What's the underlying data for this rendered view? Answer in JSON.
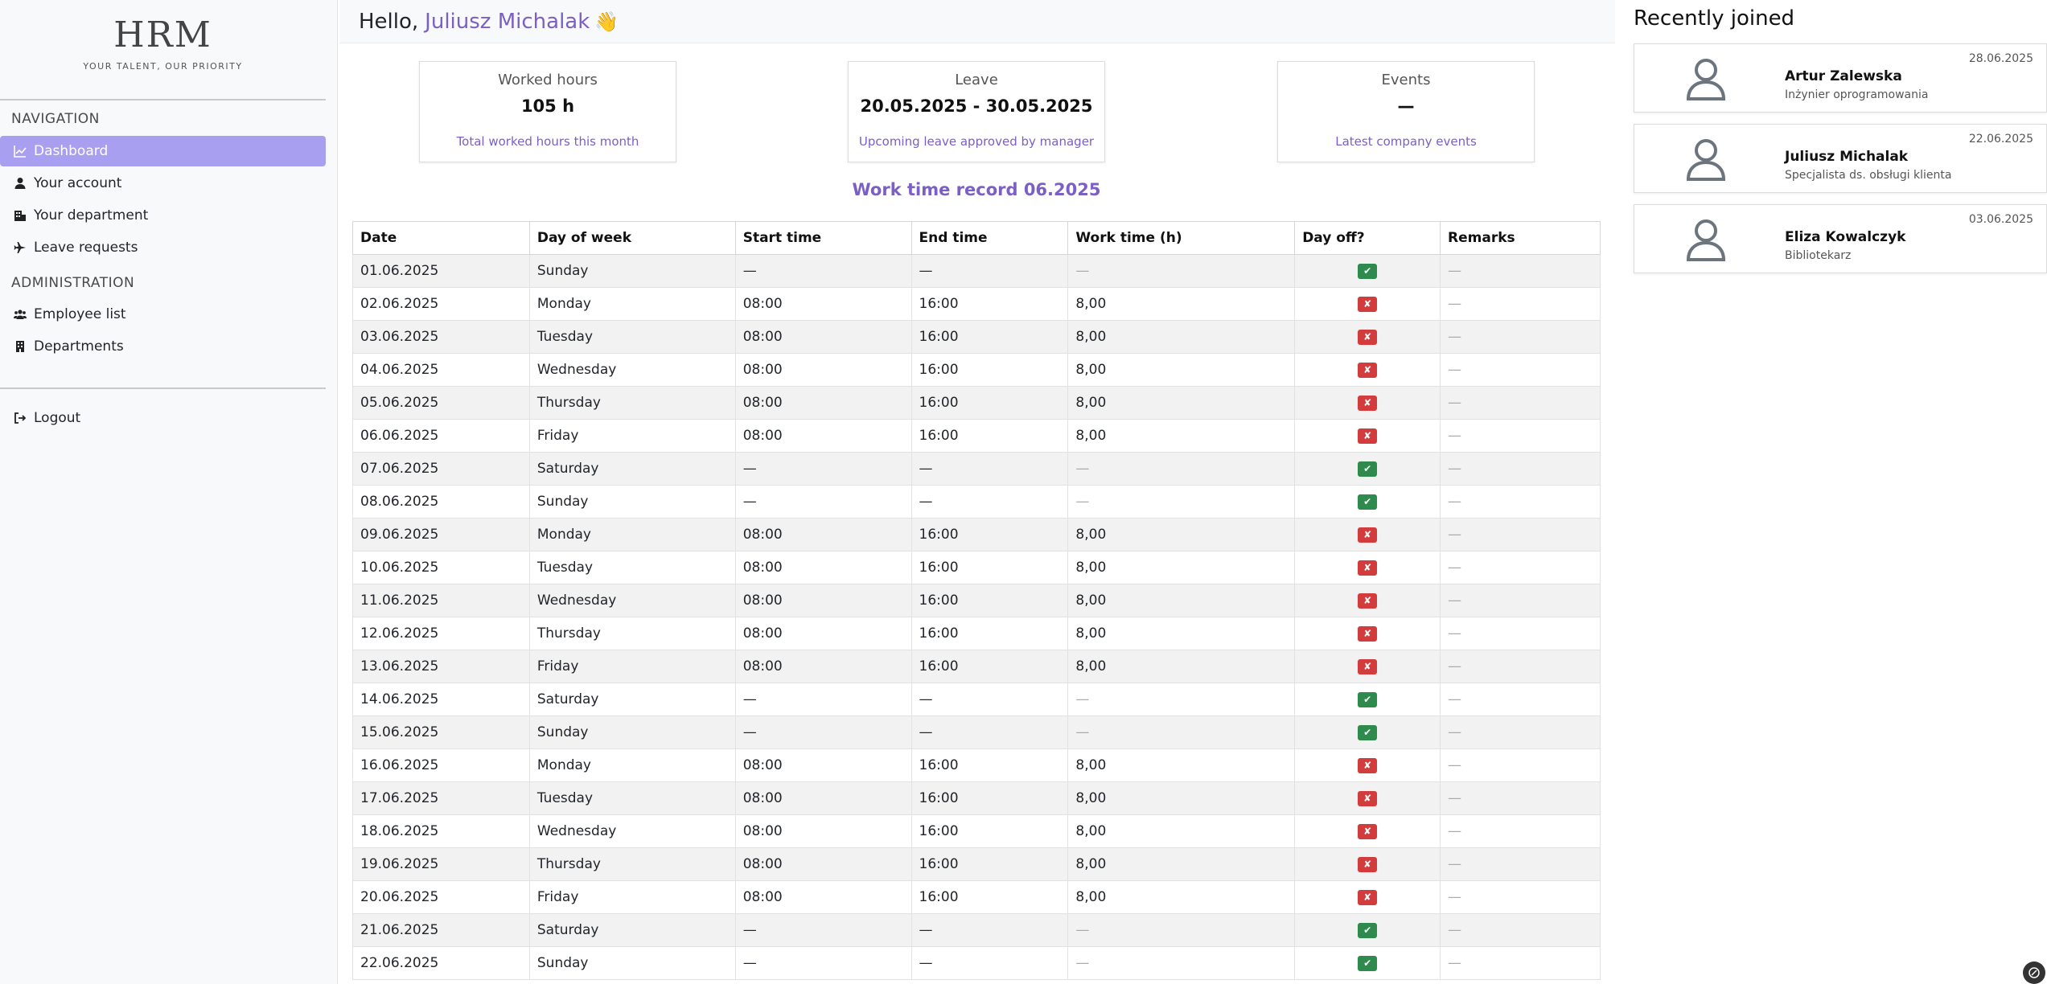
{
  "logo": {
    "title": "HRM",
    "subtitle": "YOUR TALENT, OUR PRIORITY"
  },
  "sidebar": {
    "navigation_heading": "NAVIGATION",
    "nav_items": [
      {
        "label": "Dashboard",
        "icon": "chart-line-icon",
        "active": true
      },
      {
        "label": "Your account",
        "icon": "user-icon"
      },
      {
        "label": "Your department",
        "icon": "building-icon"
      },
      {
        "label": "Leave requests",
        "icon": "plane-icon"
      }
    ],
    "administration_heading": "ADMINISTRATION",
    "admin_items": [
      {
        "label": "Employee list",
        "icon": "users-icon"
      },
      {
        "label": "Departments",
        "icon": "building-icon"
      }
    ],
    "logout_label": "Logout"
  },
  "header": {
    "greeting": "Hello,",
    "user_name": "Juliusz Michalak",
    "wave": "👋"
  },
  "cards": {
    "worked": {
      "title": "Worked hours",
      "value": "105 h",
      "desc": "Total worked hours this month"
    },
    "leave": {
      "title": "Leave",
      "value": "20.05.2025 - 30.05.2025",
      "desc": "Upcoming leave approved by manager"
    },
    "events": {
      "title": "Events",
      "value": "—",
      "desc": "Latest company events"
    }
  },
  "section_title": "Work time record 06.2025",
  "table": {
    "headers": [
      "Date",
      "Day of week",
      "Start time",
      "End time",
      "Work time (h)",
      "Day off?",
      "Remarks"
    ],
    "rows": [
      {
        "date": "01.06.2025",
        "day": "Sunday",
        "start": "—",
        "end": "—",
        "hours": "—",
        "off": true,
        "remarks": "—"
      },
      {
        "date": "02.06.2025",
        "day": "Monday",
        "start": "08:00",
        "end": "16:00",
        "hours": "8,00",
        "off": false,
        "remarks": "—"
      },
      {
        "date": "03.06.2025",
        "day": "Tuesday",
        "start": "08:00",
        "end": "16:00",
        "hours": "8,00",
        "off": false,
        "remarks": "—"
      },
      {
        "date": "04.06.2025",
        "day": "Wednesday",
        "start": "08:00",
        "end": "16:00",
        "hours": "8,00",
        "off": false,
        "remarks": "—"
      },
      {
        "date": "05.06.2025",
        "day": "Thursday",
        "start": "08:00",
        "end": "16:00",
        "hours": "8,00",
        "off": false,
        "remarks": "—"
      },
      {
        "date": "06.06.2025",
        "day": "Friday",
        "start": "08:00",
        "end": "16:00",
        "hours": "8,00",
        "off": false,
        "remarks": "—"
      },
      {
        "date": "07.06.2025",
        "day": "Saturday",
        "start": "—",
        "end": "—",
        "hours": "—",
        "off": true,
        "remarks": "—"
      },
      {
        "date": "08.06.2025",
        "day": "Sunday",
        "start": "—",
        "end": "—",
        "hours": "—",
        "off": true,
        "remarks": "—"
      },
      {
        "date": "09.06.2025",
        "day": "Monday",
        "start": "08:00",
        "end": "16:00",
        "hours": "8,00",
        "off": false,
        "remarks": "—"
      },
      {
        "date": "10.06.2025",
        "day": "Tuesday",
        "start": "08:00",
        "end": "16:00",
        "hours": "8,00",
        "off": false,
        "remarks": "—"
      },
      {
        "date": "11.06.2025",
        "day": "Wednesday",
        "start": "08:00",
        "end": "16:00",
        "hours": "8,00",
        "off": false,
        "remarks": "—"
      },
      {
        "date": "12.06.2025",
        "day": "Thursday",
        "start": "08:00",
        "end": "16:00",
        "hours": "8,00",
        "off": false,
        "remarks": "—"
      },
      {
        "date": "13.06.2025",
        "day": "Friday",
        "start": "08:00",
        "end": "16:00",
        "hours": "8,00",
        "off": false,
        "remarks": "—"
      },
      {
        "date": "14.06.2025",
        "day": "Saturday",
        "start": "—",
        "end": "—",
        "hours": "—",
        "off": true,
        "remarks": "—"
      },
      {
        "date": "15.06.2025",
        "day": "Sunday",
        "start": "—",
        "end": "—",
        "hours": "—",
        "off": true,
        "remarks": "—"
      },
      {
        "date": "16.06.2025",
        "day": "Monday",
        "start": "08:00",
        "end": "16:00",
        "hours": "8,00",
        "off": false,
        "remarks": "—"
      },
      {
        "date": "17.06.2025",
        "day": "Tuesday",
        "start": "08:00",
        "end": "16:00",
        "hours": "8,00",
        "off": false,
        "remarks": "—"
      },
      {
        "date": "18.06.2025",
        "day": "Wednesday",
        "start": "08:00",
        "end": "16:00",
        "hours": "8,00",
        "off": false,
        "remarks": "—"
      },
      {
        "date": "19.06.2025",
        "day": "Thursday",
        "start": "08:00",
        "end": "16:00",
        "hours": "8,00",
        "off": false,
        "remarks": "—"
      },
      {
        "date": "20.06.2025",
        "day": "Friday",
        "start": "08:00",
        "end": "16:00",
        "hours": "8,00",
        "off": false,
        "remarks": "—"
      },
      {
        "date": "21.06.2025",
        "day": "Saturday",
        "start": "—",
        "end": "—",
        "hours": "—",
        "off": true,
        "remarks": "—"
      },
      {
        "date": "22.06.2025",
        "day": "Sunday",
        "start": "—",
        "end": "—",
        "hours": "—",
        "off": true,
        "remarks": "—"
      }
    ]
  },
  "badges": {
    "yes": "✔",
    "no": "✘",
    "yes_color": "#2f8a4e",
    "no_color": "#d23c3c"
  },
  "recently_joined": {
    "title": "Recently joined",
    "people": [
      {
        "name": "Artur Zalewska",
        "role": "Inżynier oprogramowania",
        "date": "28.06.2025"
      },
      {
        "name": "Juliusz Michalak",
        "role": "Specjalista ds. obsługi klienta",
        "date": "22.06.2025"
      },
      {
        "name": "Eliza Kowalczyk",
        "role": "Bibliotekarz",
        "date": "03.06.2025"
      }
    ]
  },
  "colors": {
    "accent": "#7b5fc4",
    "active_nav": "#a99ff0"
  }
}
